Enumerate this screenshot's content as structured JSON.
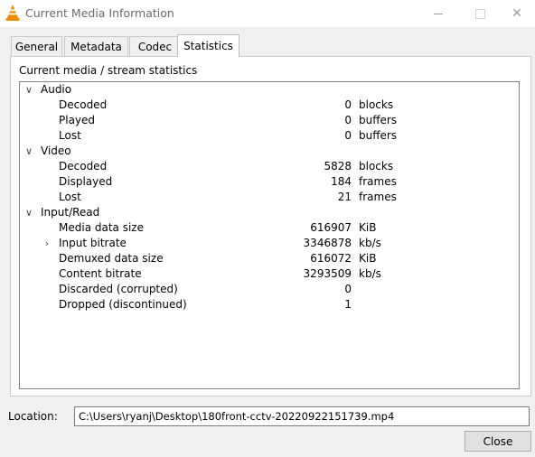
{
  "window": {
    "title": "Current Media Information",
    "minimize_glyph": "—",
    "close_glyph": "✕"
  },
  "tabs": [
    {
      "label": "General"
    },
    {
      "label": "Metadata"
    },
    {
      "label": "Codec"
    },
    {
      "label": "Statistics"
    }
  ],
  "active_tab": "Statistics",
  "stats": {
    "caption": "Current media / stream statistics",
    "groups": [
      {
        "label": "Audio",
        "items": [
          {
            "label": "Decoded",
            "value": "0",
            "unit": "blocks"
          },
          {
            "label": "Played",
            "value": "0",
            "unit": "buffers"
          },
          {
            "label": "Lost",
            "value": "0",
            "unit": "buffers"
          }
        ]
      },
      {
        "label": "Video",
        "items": [
          {
            "label": "Decoded",
            "value": "5828",
            "unit": "blocks"
          },
          {
            "label": "Displayed",
            "value": "184",
            "unit": "frames"
          },
          {
            "label": "Lost",
            "value": "21",
            "unit": "frames"
          }
        ]
      },
      {
        "label": "Input/Read",
        "items": [
          {
            "label": "Media data size",
            "value": "616907",
            "unit": "KiB"
          },
          {
            "label": "Input bitrate",
            "value": "3346878",
            "unit": "kb/s"
          },
          {
            "label": "Demuxed data size",
            "value": "616072",
            "unit": "KiB"
          },
          {
            "label": "Content bitrate",
            "value": "3293509",
            "unit": "kb/s"
          },
          {
            "label": "Discarded (corrupted)",
            "value": "0",
            "unit": ""
          },
          {
            "label": "Dropped (discontinued)",
            "value": "1",
            "unit": ""
          }
        ]
      }
    ]
  },
  "location": {
    "label": "Location:",
    "value": "C:\\Users\\ryanj\\Desktop\\180front-cctv-20220922151739.mp4"
  },
  "buttons": {
    "close_label": "Close"
  },
  "colors": {
    "window_bg": "#f0f0f0",
    "panel_bg": "#ffffff",
    "vlc_orange": "#f08c00"
  }
}
